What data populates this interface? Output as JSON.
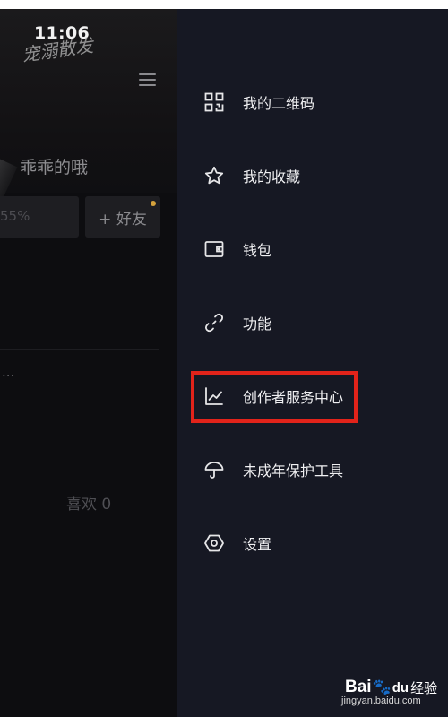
{
  "status_bar": {
    "time": "11:06"
  },
  "profile": {
    "watermark_text": "宠溺散发",
    "username": "乖乖的哦",
    "stat_partial": "55%",
    "add_friend_label": "+ 好友",
    "ellipsis": "...",
    "likes_tab": "喜欢 0"
  },
  "drawer": {
    "items": [
      {
        "label": "我的二维码",
        "icon": "qr-code-icon"
      },
      {
        "label": "我的收藏",
        "icon": "star-icon"
      },
      {
        "label": "钱包",
        "icon": "wallet-icon"
      },
      {
        "label": "功能",
        "icon": "link-icon"
      },
      {
        "label": "创作者服务中心",
        "icon": "trend-chart-icon",
        "highlighted": true
      },
      {
        "label": "未成年保护工具",
        "icon": "umbrella-icon"
      },
      {
        "label": "设置",
        "icon": "hexagon-settings-icon"
      }
    ],
    "highlight_color": "#e2231a"
  },
  "watermark": {
    "brand_bai": "Bai",
    "brand_du": "du",
    "brand_suffix": "经验",
    "url": "jingyan.baidu.com"
  },
  "colors": {
    "drawer_bg": "#161823",
    "left_bg": "#0d0d10",
    "accent_dot": "#d5a23c"
  }
}
